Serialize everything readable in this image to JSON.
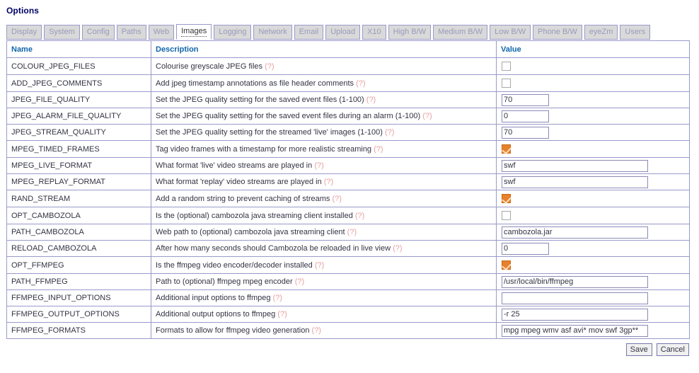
{
  "page": {
    "title": "Options"
  },
  "colors": {
    "title": "#000066",
    "table_border": "#9999cc",
    "column_header": "#1166aa",
    "help_link": "#e8a0a0",
    "checkbox_checked": "#e8812c",
    "tab_inactive_bg": "#d9d9d9",
    "tab_inactive_text": "#9999bb",
    "tab_active_bg": "#ffffff"
  },
  "tabs": [
    {
      "label": "Display",
      "active": false
    },
    {
      "label": "System",
      "active": false
    },
    {
      "label": "Config",
      "active": false
    },
    {
      "label": "Paths",
      "active": false
    },
    {
      "label": "Web",
      "active": false
    },
    {
      "label": "Images",
      "active": true
    },
    {
      "label": "Logging",
      "active": false
    },
    {
      "label": "Network",
      "active": false
    },
    {
      "label": "Email",
      "active": false
    },
    {
      "label": "Upload",
      "active": false
    },
    {
      "label": "X10",
      "active": false
    },
    {
      "label": "High B/W",
      "active": false
    },
    {
      "label": "Medium B/W",
      "active": false
    },
    {
      "label": "Low B/W",
      "active": false
    },
    {
      "label": "Phone B/W",
      "active": false
    },
    {
      "label": "eyeZm",
      "active": false
    },
    {
      "label": "Users",
      "active": false
    }
  ],
  "table": {
    "columns": [
      "Name",
      "Description",
      "Value"
    ],
    "help_label": "(?)",
    "rows": [
      {
        "name": "COLOUR_JPEG_FILES",
        "description": "Colourise greyscale JPEG files",
        "control": "checkbox",
        "checked": false,
        "value": ""
      },
      {
        "name": "ADD_JPEG_COMMENTS",
        "description": "Add jpeg timestamp annotations as file header comments",
        "control": "checkbox",
        "checked": false,
        "value": ""
      },
      {
        "name": "JPEG_FILE_QUALITY",
        "description": "Set the JPEG quality setting for the saved event files (1-100)",
        "control": "text-narrow",
        "checked": false,
        "value": "70"
      },
      {
        "name": "JPEG_ALARM_FILE_QUALITY",
        "description": "Set the JPEG quality setting for the saved event files during an alarm (1-100)",
        "control": "text-narrow",
        "checked": false,
        "value": "0"
      },
      {
        "name": "JPEG_STREAM_QUALITY",
        "description": "Set the JPEG quality setting for the streamed 'live' images (1-100)",
        "control": "text-narrow",
        "checked": false,
        "value": "70"
      },
      {
        "name": "MPEG_TIMED_FRAMES",
        "description": "Tag video frames with a timestamp for more realistic streaming",
        "control": "checkbox",
        "checked": true,
        "value": ""
      },
      {
        "name": "MPEG_LIVE_FORMAT",
        "description": "What format 'live' video streams are played in",
        "control": "text-wide",
        "checked": false,
        "value": "swf"
      },
      {
        "name": "MPEG_REPLAY_FORMAT",
        "description": "What format 'replay' video streams are played in",
        "control": "text-wide",
        "checked": false,
        "value": "swf"
      },
      {
        "name": "RAND_STREAM",
        "description": "Add a random string to prevent caching of streams",
        "control": "checkbox",
        "checked": true,
        "value": ""
      },
      {
        "name": "OPT_CAMBOZOLA",
        "description": "Is the (optional) cambozola java streaming client installed",
        "control": "checkbox",
        "checked": false,
        "value": ""
      },
      {
        "name": "PATH_CAMBOZOLA",
        "description": "Web path to (optional) cambozola java streaming client",
        "control": "text-wide",
        "checked": false,
        "value": "cambozola.jar"
      },
      {
        "name": "RELOAD_CAMBOZOLA",
        "description": "After how many seconds should Cambozola be reloaded in live view",
        "control": "text-narrow",
        "checked": false,
        "value": "0"
      },
      {
        "name": "OPT_FFMPEG",
        "description": "Is the ffmpeg video encoder/decoder installed",
        "control": "checkbox",
        "checked": true,
        "value": ""
      },
      {
        "name": "PATH_FFMPEG",
        "description": "Path to (optional) ffmpeg mpeg encoder",
        "control": "text-wide",
        "checked": false,
        "value": "/usr/local/bin/ffmpeg"
      },
      {
        "name": "FFMPEG_INPUT_OPTIONS",
        "description": "Additional input options to ffmpeg",
        "control": "text-wide",
        "checked": false,
        "value": ""
      },
      {
        "name": "FFMPEG_OUTPUT_OPTIONS",
        "description": "Additional output options to ffmpeg",
        "control": "text-wide",
        "checked": false,
        "value": "-r 25"
      },
      {
        "name": "FFMPEG_FORMATS",
        "description": "Formats to allow for ffmpeg video generation",
        "control": "text-wide",
        "checked": false,
        "value": "mpg mpeg wmv asf avi* mov swf 3gp**"
      }
    ]
  },
  "footer": {
    "save_label": "Save",
    "cancel_label": "Cancel"
  }
}
